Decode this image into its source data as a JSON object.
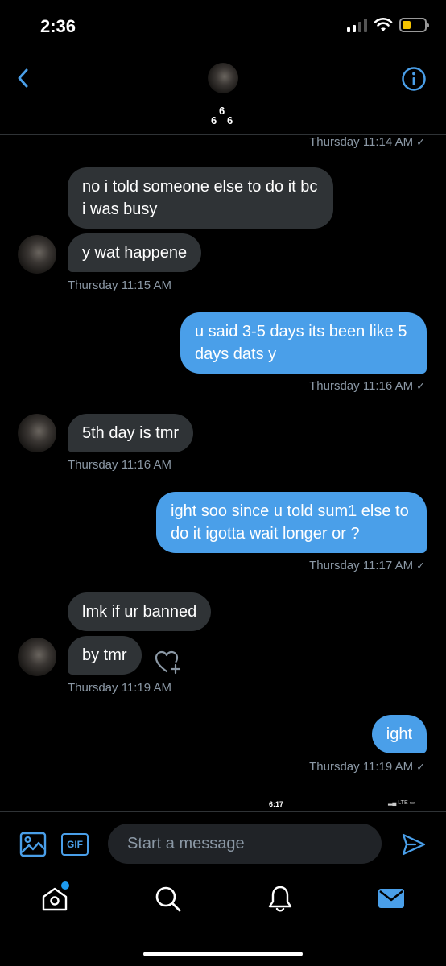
{
  "status_bar": {
    "time": "2:36"
  },
  "header": {
    "name_chars": [
      "6",
      "6",
      "6"
    ]
  },
  "messages": [
    {
      "ts": "Thursday 11:14 AM",
      "check": "✓"
    },
    {
      "text": "no i told someone else to do it bc i was busy"
    },
    {
      "text": "y wat happene"
    },
    {
      "ts": "Thursday 11:15 AM"
    },
    {
      "text": "u said 3-5 days its been like 5 days dats y"
    },
    {
      "ts": "Thursday 11:16 AM",
      "check": "✓"
    },
    {
      "text": "5th day is tmr"
    },
    {
      "ts": "Thursday 11:16 AM"
    },
    {
      "text": "ight soo since u told sum1 else to do it igotta wait longer or ?"
    },
    {
      "ts": "Thursday 11:17 AM",
      "check": "✓"
    },
    {
      "text": "lmk if ur banned"
    },
    {
      "text": "by tmr"
    },
    {
      "ts": "Thursday 11:19 AM"
    },
    {
      "text": "ight"
    },
    {
      "ts": "Thursday 11:19 AM",
      "check": "✓"
    }
  ],
  "overlay_status": {
    "time": "6:17",
    "network": "LTE"
  },
  "composer": {
    "gif_label": "GIF",
    "placeholder": "Start a message"
  },
  "colors": {
    "accent": "#4a9fe9",
    "incoming_bubble": "#2f3336",
    "background": "#000000",
    "timestamp": "#8b98a5"
  },
  "icons": [
    "back-arrow-icon",
    "info-icon",
    "image-icon",
    "send-icon",
    "home-icon",
    "search-icon",
    "bell-icon",
    "mail-icon",
    "heart-add-icon"
  ]
}
